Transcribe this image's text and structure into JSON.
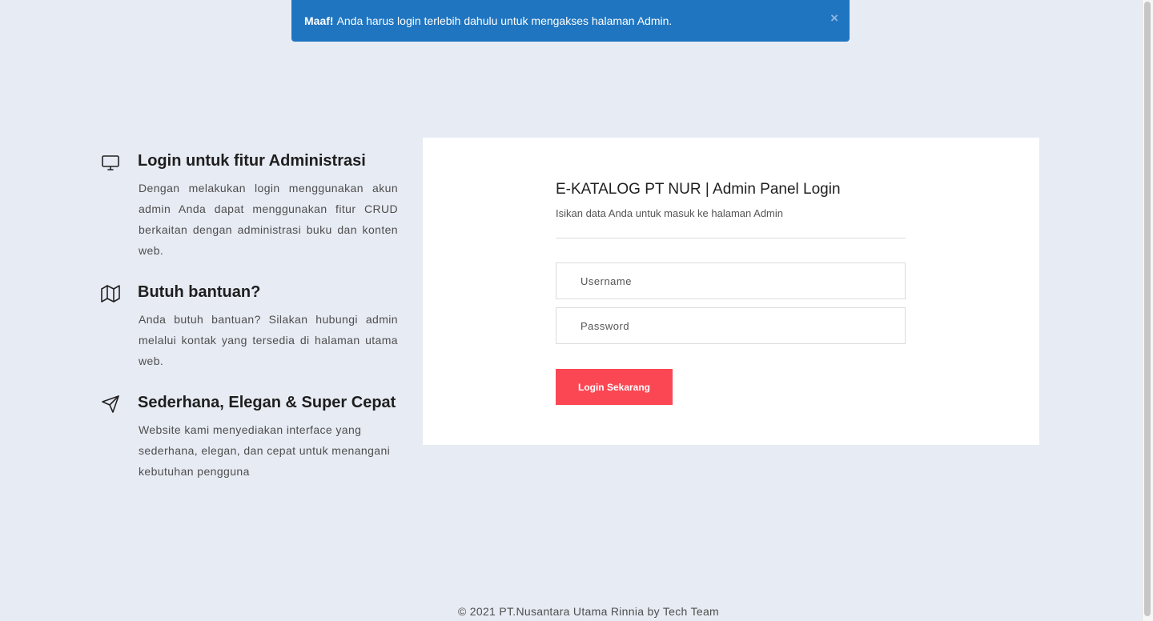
{
  "alert": {
    "strong": "Maaf!",
    "message": "Anda harus login terlebih dahulu untuk mengakses halaman Admin.",
    "close_symbol": "×"
  },
  "features": [
    {
      "icon": "monitor-icon",
      "title": "Login untuk fitur Administrasi",
      "text": "Dengan melakukan login menggunakan akun admin Anda dapat menggunakan fitur CRUD berkaitan dengan administrasi buku dan konten web."
    },
    {
      "icon": "map-icon",
      "title": "Butuh bantuan?",
      "text": "Anda butuh bantuan? Silakan hubungi admin melalui kontak yang tersedia di halaman utama web."
    },
    {
      "icon": "paper-plane-icon",
      "title": "Sederhana, Elegan & Super Cepat",
      "text": "Website kami menyediakan interface yang sederhana, elegan, dan cepat untuk menangani kebutuhan pengguna"
    }
  ],
  "login": {
    "title": "E-KATALOG PT NUR | Admin Panel Login",
    "subtitle": "Isikan data Anda untuk masuk ke halaman Admin",
    "username_placeholder": "Username",
    "username_value": "",
    "password_placeholder": "Password",
    "password_value": "",
    "button_label": "Login Sekarang"
  },
  "footer": {
    "text": "© 2021 PT.Nusantara Utama Rinnia by Tech Team"
  },
  "colors": {
    "alert_bg": "#1f75c0",
    "button_bg": "#fb4754",
    "page_bg": "#e7ebf3"
  }
}
